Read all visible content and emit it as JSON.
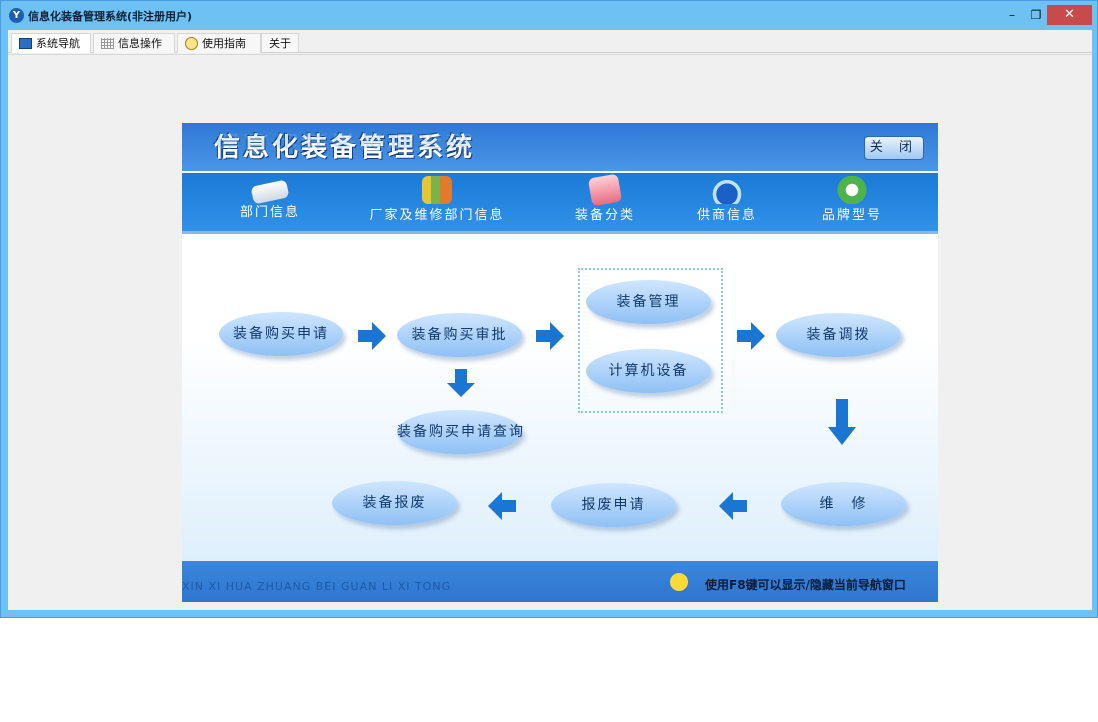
{
  "window": {
    "title": "信息化装备管理系统(非注册用户)",
    "icon": "app-icon",
    "controls": {
      "minimize": "–",
      "restore": "❐",
      "close": "✕"
    }
  },
  "tabs": [
    {
      "label": "系统导航",
      "icon": "monitor-icon"
    },
    {
      "label": "信息操作",
      "icon": "grid-icon"
    },
    {
      "label": "使用指南",
      "icon": "clock-icon"
    },
    {
      "label": "关于",
      "icon": ""
    }
  ],
  "panel": {
    "title": "信息化装备管理系统",
    "close_label": "关 闭"
  },
  "nav": [
    {
      "label": "部门信息",
      "icon": "book-icon"
    },
    {
      "label": "厂家及维修部门信息",
      "icon": "files-icon"
    },
    {
      "label": "装备分类",
      "icon": "stack-icon"
    },
    {
      "label": "供商信息",
      "icon": "flask-icon"
    },
    {
      "label": "品牌型号",
      "icon": "recycle-icon"
    }
  ],
  "flow": {
    "purchase_apply": "装备购买申请",
    "purchase_approve": "装备购买审批",
    "purchase_query": "装备购买申请查询",
    "equip_manage": "装备管理",
    "computer_equip": "计算机设备",
    "equip_transfer": "装备调拨",
    "repair": "维　修",
    "scrap_apply": "报废申请",
    "equip_scrap": "装备报废"
  },
  "footer": {
    "pinyin": "XIN XI HUA ZHUANG BEI GUAN LI XI TONG",
    "tip": "使用F8键可以显示/隐藏当前导航窗口"
  },
  "colors": {
    "titlebar": "#6ec1f3",
    "accent": "#1a76d2",
    "close_button": "#c94a4a"
  }
}
